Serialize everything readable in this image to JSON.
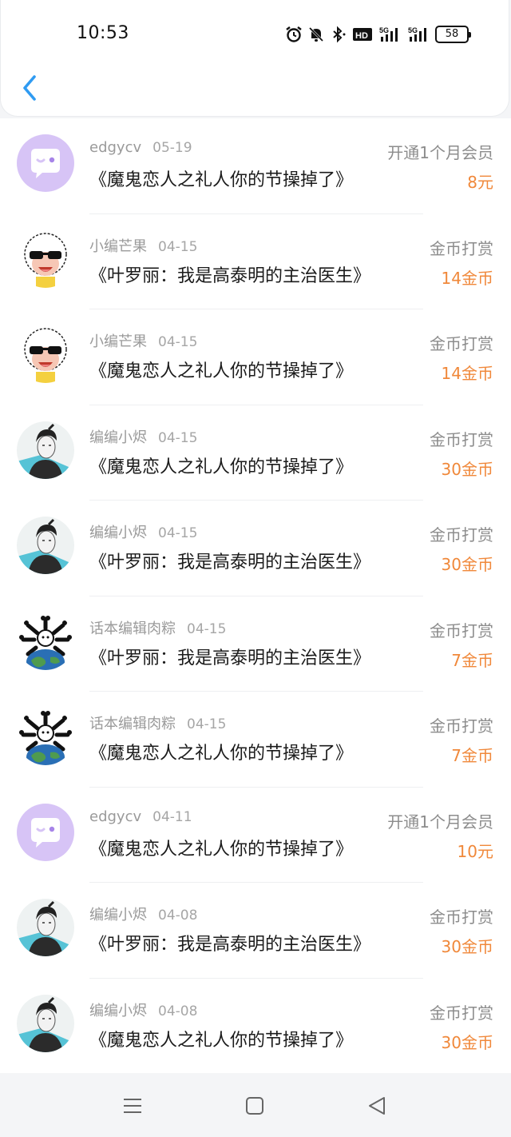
{
  "status_bar": {
    "time": "10:53",
    "battery": "58",
    "icons": [
      "alarm-icon",
      "mute-icon",
      "bluetooth-icon",
      "hd-icon",
      "5g-signal-icon",
      "5g-signal-icon",
      "battery-icon"
    ]
  },
  "header": {
    "back_icon": "chevron-left-icon"
  },
  "colors": {
    "accent_back": "#2f9bf2",
    "amount": "#f0883a",
    "name_gray": "#9a9a9a",
    "title_black": "#1b1b1b"
  },
  "records": [
    {
      "name": "edgycv",
      "date": "05-19",
      "title": "《魔鬼恋人之礼人你的节操掉了》",
      "type": "开通1个月会员",
      "amount": "8元",
      "avatar": "chat-bubble-avatar"
    },
    {
      "name": "小编芒果",
      "date": "04-15",
      "title": "《叶罗丽：我是高泰明的主治医生》",
      "type": "金币打赏",
      "amount": "14金币",
      "avatar": "sheep-sunglasses-avatar"
    },
    {
      "name": "小编芒果",
      "date": "04-15",
      "title": "《魔鬼恋人之礼人你的节操掉了》",
      "type": "金币打赏",
      "amount": "14金币",
      "avatar": "sheep-sunglasses-avatar"
    },
    {
      "name": "编编小烬",
      "date": "04-15",
      "title": "《魔鬼恋人之礼人你的节操掉了》",
      "type": "金币打赏",
      "amount": "30金币",
      "avatar": "anime-man-avatar"
    },
    {
      "name": "编编小烬",
      "date": "04-15",
      "title": "《叶罗丽：我是高泰明的主治医生》",
      "type": "金币打赏",
      "amount": "30金币",
      "avatar": "anime-man-avatar"
    },
    {
      "name": "话本编辑肉粽",
      "date": "04-15",
      "title": "《叶罗丽：我是高泰明的主治医生》",
      "type": "金币打赏",
      "amount": "7金币",
      "avatar": "bones-earth-avatar"
    },
    {
      "name": "话本编辑肉粽",
      "date": "04-15",
      "title": "《魔鬼恋人之礼人你的节操掉了》",
      "type": "金币打赏",
      "amount": "7金币",
      "avatar": "bones-earth-avatar"
    },
    {
      "name": "edgycv",
      "date": "04-11",
      "title": "《魔鬼恋人之礼人你的节操掉了》",
      "type": "开通1个月会员",
      "amount": "10元",
      "avatar": "chat-bubble-avatar"
    },
    {
      "name": "编编小烬",
      "date": "04-08",
      "title": "《叶罗丽：我是高泰明的主治医生》",
      "type": "金币打赏",
      "amount": "30金币",
      "avatar": "anime-man-avatar"
    },
    {
      "name": "编编小烬",
      "date": "04-08",
      "title": "《魔鬼恋人之礼人你的节操掉了》",
      "type": "金币打赏",
      "amount": "30金币",
      "avatar": "anime-man-avatar"
    }
  ],
  "nav_bar": {
    "icons": [
      "menu-icon",
      "home-square-icon",
      "back-triangle-icon"
    ]
  }
}
